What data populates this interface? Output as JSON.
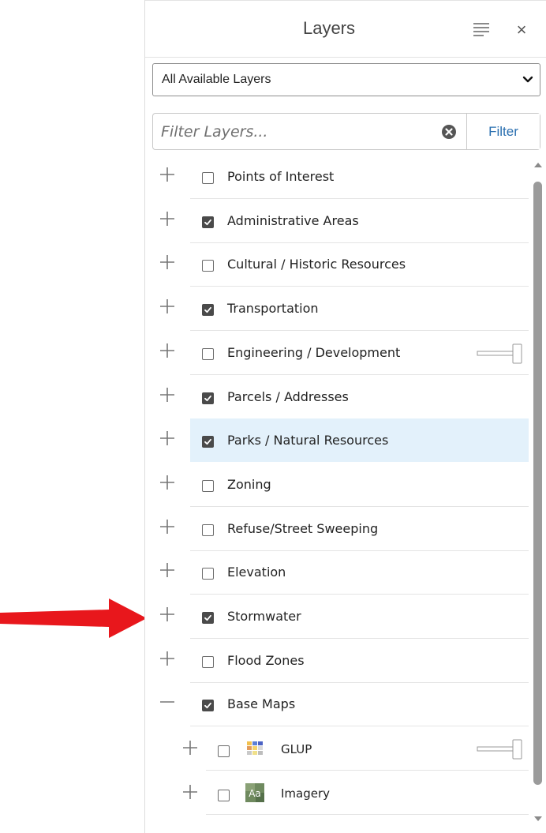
{
  "panel": {
    "title": "Layers",
    "menu_icon": "list-icon",
    "close_glyph": "×"
  },
  "layer_select": {
    "value": "All Available Layers"
  },
  "filter": {
    "placeholder": "Filter Layers...",
    "button_label": "Filter"
  },
  "layers": [
    {
      "label": "Points of Interest",
      "checked": false,
      "expanded": false
    },
    {
      "label": "Administrative Areas",
      "checked": true,
      "expanded": false
    },
    {
      "label": "Cultural / Historic Resources",
      "checked": false,
      "expanded": false
    },
    {
      "label": "Transportation",
      "checked": true,
      "expanded": false
    },
    {
      "label": "Engineering / Development",
      "checked": false,
      "expanded": false,
      "opacity_slider": true
    },
    {
      "label": "Parcels / Addresses",
      "checked": true,
      "expanded": false
    },
    {
      "label": "Parks / Natural Resources",
      "checked": true,
      "expanded": false,
      "highlighted": true
    },
    {
      "label": "Zoning",
      "checked": false,
      "expanded": false
    },
    {
      "label": "Refuse/Street Sweeping",
      "checked": false,
      "expanded": false
    },
    {
      "label": "Elevation",
      "checked": false,
      "expanded": false
    },
    {
      "label": "Stormwater",
      "checked": true,
      "expanded": false,
      "pointed_at_by_arrow": true
    },
    {
      "label": "Flood Zones",
      "checked": false,
      "expanded": false
    },
    {
      "label": "Base Maps",
      "checked": true,
      "expanded": true
    }
  ],
  "base_map_sublayers": [
    {
      "label": "GLUP",
      "checked": false,
      "thumbnail": "land-use-thumbnail",
      "opacity_slider": true
    },
    {
      "label": "Imagery",
      "checked": false,
      "thumbnail": "imagery-thumbnail"
    }
  ],
  "colors": {
    "highlight_row": "#e3f1fb",
    "accent_link": "#2a6fb0",
    "arrow": "#e8171c",
    "checkbox_checked": "#4a4a4a"
  }
}
